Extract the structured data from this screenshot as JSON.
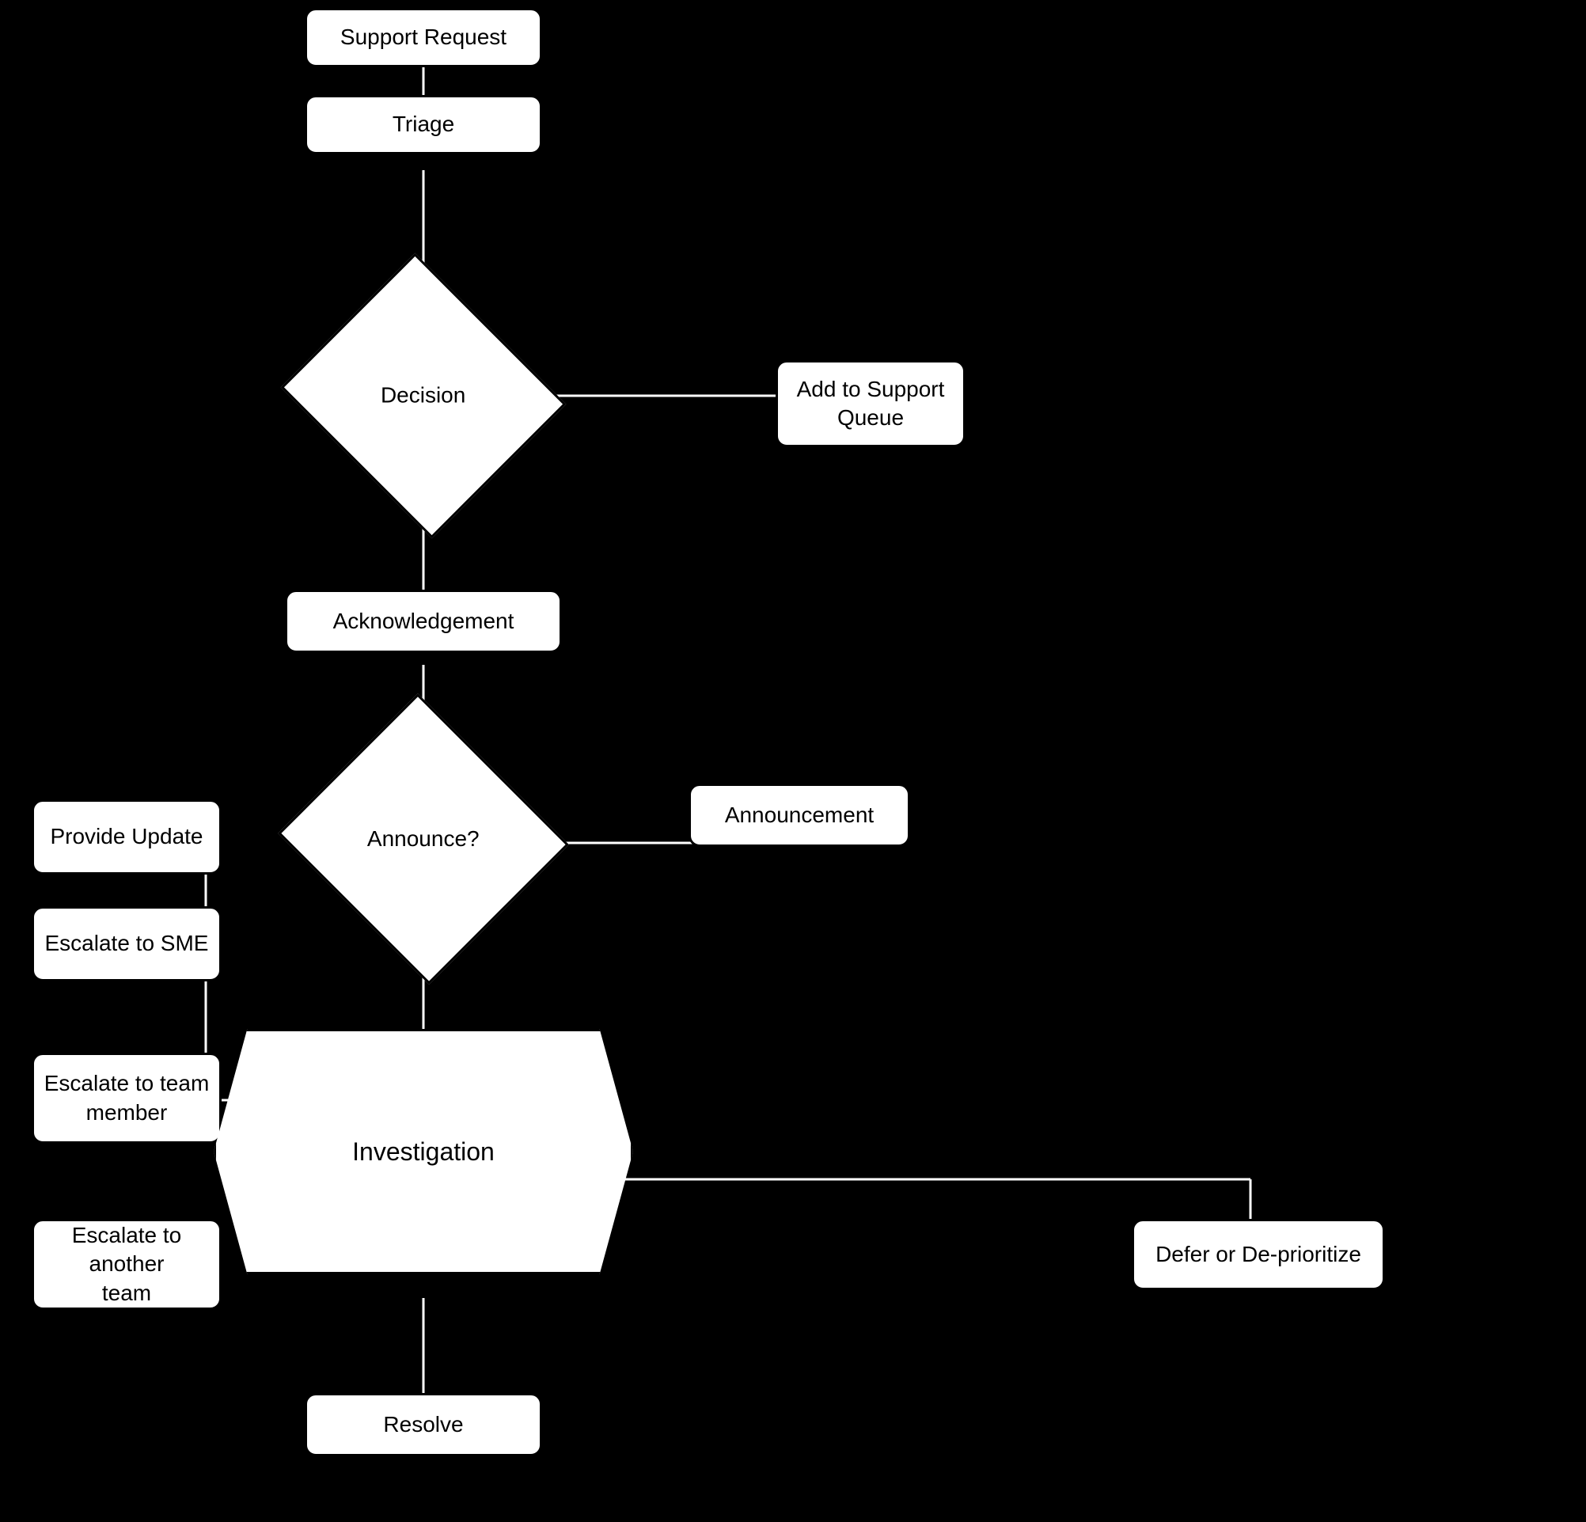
{
  "nodes": {
    "support_request": {
      "label": "Support Request"
    },
    "triage": {
      "label": "Triage"
    },
    "decision": {
      "label": "Decision"
    },
    "add_to_support_queue": {
      "label": "Add to Support\nQueue"
    },
    "acknowledgement": {
      "label": "Acknowledgement"
    },
    "announce": {
      "label": "Announce?"
    },
    "announcement": {
      "label": "Announcement"
    },
    "provide_update": {
      "label": "Provide Update"
    },
    "escalate_sme": {
      "label": "Escalate to SME"
    },
    "escalate_team_member": {
      "label": "Escalate to team\nmember"
    },
    "escalate_another_team": {
      "label": "Escalate to another\nteam"
    },
    "investigation": {
      "label": "Investigation"
    },
    "defer_deprioritize": {
      "label": "Defer or De-prioritize"
    },
    "resolve": {
      "label": "Resolve"
    }
  }
}
